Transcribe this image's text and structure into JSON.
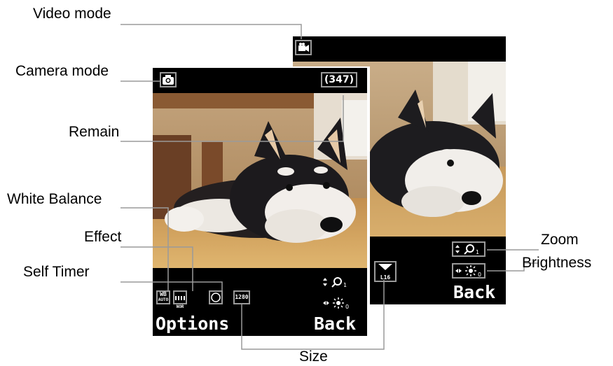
{
  "labels": {
    "video_mode": "Video mode",
    "camera_mode": "Camera mode",
    "remain": "Remain",
    "white_balance": "White Balance",
    "effect": "Effect",
    "self_timer": "Self Timer",
    "zoom": "Zoom",
    "brightness": "Brightness",
    "size": "Size"
  },
  "camera_screen": {
    "remain_count": "(347)",
    "wb_line1": "WB",
    "wb_line2": "AUTO",
    "effect_text": "NOR",
    "size_text": "1280",
    "left_softkey": "Options",
    "right_softkey": "Back"
  },
  "video_screen": {
    "size_text": "L16",
    "right_softkey": "Back"
  },
  "icons": [
    "camera-icon",
    "video-camera-icon",
    "zoom-icon",
    "brightness-icon",
    "self-timer-icon"
  ],
  "colors": {
    "leader_line": "#9a9a9a",
    "screen_bar": "#000000",
    "floor": "#c89a5a",
    "wall": "#d9c2a3"
  }
}
